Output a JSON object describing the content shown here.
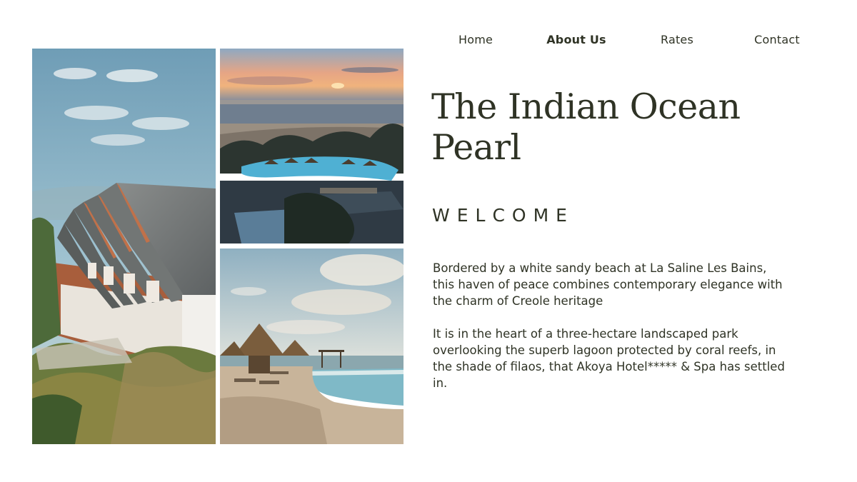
{
  "nav": {
    "items": [
      {
        "label": "Home",
        "active": false
      },
      {
        "label": "About Us",
        "active": true
      },
      {
        "label": "Rates",
        "active": false
      },
      {
        "label": "Contact",
        "active": false
      }
    ]
  },
  "hero": {
    "title": "The Indian Ocean Pearl",
    "subtitle": "WELCOME"
  },
  "content": {
    "paragraphs": [
      "Bordered by a white sandy beach at La Saline Les Bains, this haven of peace combines contemporary elegance with the charm of Creole heritage",
      "It is in the heart of a three-hectare landscaped park overlooking the superb lagoon protected by coral reefs, in the shade of filaos, that Akoya Hotel***** & Spa has settled in."
    ]
  },
  "gallery": {
    "images": [
      {
        "name": "hotel-facade-photo"
      },
      {
        "name": "sunset-pool-photo"
      },
      {
        "name": "beach-pool-photo"
      }
    ]
  },
  "colors": {
    "text": "#2f3325",
    "background": "#ffffff"
  }
}
